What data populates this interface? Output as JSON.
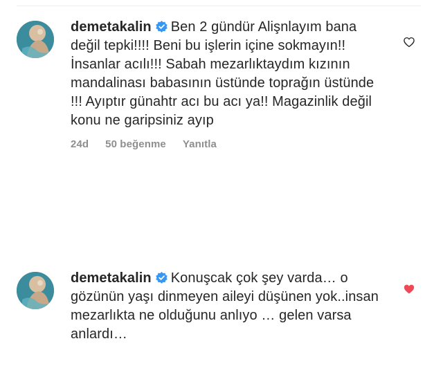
{
  "comments": [
    {
      "username": "demetakalin",
      "verified": true,
      "text": "Ben 2 gündür Alişnlayım bana değil tepki!!!! Beni bu işlerin içine sokmayın!! İnsanlar acılı!!! Sabah mezarlıktaydım kızının mandalinası babasının üstünde toprağın üstünde !!! Ayıptır günahtr acı bu acı ya!! Magazinlik değil konu ne garipsiniz ayıp",
      "time": "24d",
      "likes": "50 beğenme",
      "reply_label": "Yanıtla",
      "liked": false
    },
    {
      "username": "demetakalin",
      "verified": true,
      "text": "Konuşcak çok şey varda… o gözünün yaşı dinmeyen aileyi düşünen yok..insan mezarlıkta ne olduğunu anlıyo … gelen varsa anlardı…",
      "liked": true
    }
  ],
  "colors": {
    "text": "#262626",
    "muted": "#8e8e8e",
    "verified": "#3897f0",
    "heart_liked": "#ed4956"
  },
  "icons": {
    "verified": "verified-badge-icon",
    "heart_outline": "heart-outline-icon",
    "heart_filled": "heart-filled-icon"
  }
}
